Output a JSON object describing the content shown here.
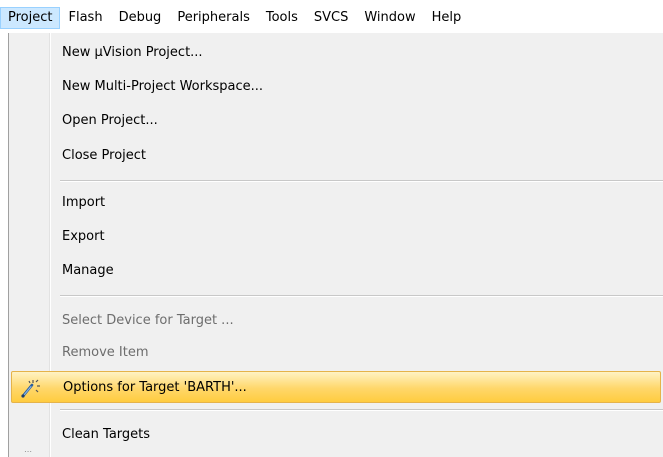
{
  "menubar": {
    "items": [
      "Project",
      "Flash",
      "Debug",
      "Peripherals",
      "Tools",
      "SVCS",
      "Window",
      "Help"
    ]
  },
  "dropdown": {
    "new_uvision_project": "New µVision Project...",
    "new_multi_project_workspace": "New Multi-Project Workspace...",
    "open_project": "Open Project...",
    "close_project": "Close Project",
    "import": "Import",
    "export": "Export",
    "manage": "Manage",
    "select_device": "Select Device for Target ...",
    "remove_item": "Remove Item",
    "options_for_target": "Options for Target 'BARTH'...",
    "clean_targets": "Clean Targets"
  },
  "icons": {
    "options_for_target": "magic-wand-options-icon"
  },
  "colors": {
    "menubar_active_bg": "#cce8ff",
    "highlight": "#ffd76a",
    "disabled_text": "#6d6d6d"
  }
}
